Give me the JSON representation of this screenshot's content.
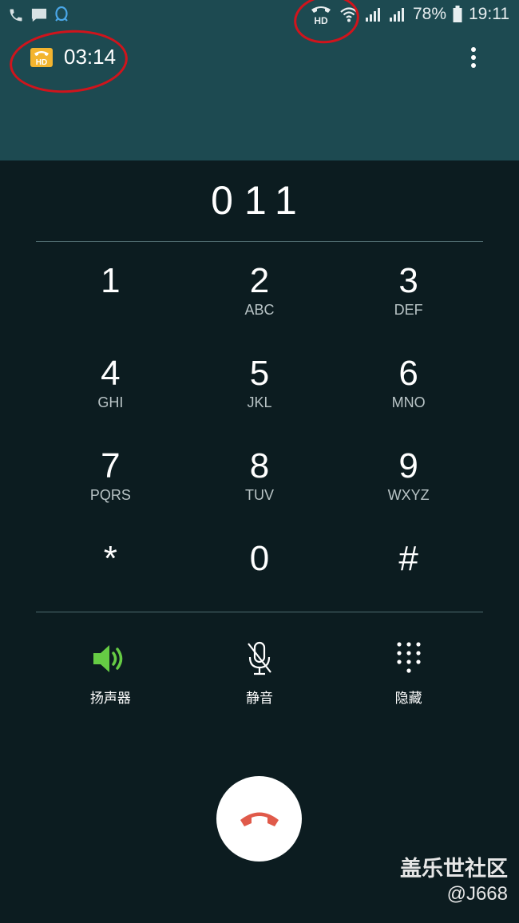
{
  "status_bar": {
    "battery": "78%",
    "time": "19:11",
    "icons_left": [
      "phone-icon",
      "message-icon",
      "qq-icon"
    ],
    "icons_right": [
      "hd-call-icon",
      "wifi-icon",
      "signal-icon",
      "signal-icon",
      "battery-icon"
    ]
  },
  "call": {
    "duration": "03:14",
    "hd_label": "HD"
  },
  "dialed_number": "011",
  "keypad": [
    {
      "digit": "1",
      "letters": ""
    },
    {
      "digit": "2",
      "letters": "ABC"
    },
    {
      "digit": "3",
      "letters": "DEF"
    },
    {
      "digit": "4",
      "letters": "GHI"
    },
    {
      "digit": "5",
      "letters": "JKL"
    },
    {
      "digit": "6",
      "letters": "MNO"
    },
    {
      "digit": "7",
      "letters": "PQRS"
    },
    {
      "digit": "8",
      "letters": "TUV"
    },
    {
      "digit": "9",
      "letters": "WXYZ"
    },
    {
      "digit": "*",
      "letters": ""
    },
    {
      "digit": "0",
      "letters": ""
    },
    {
      "digit": "#",
      "letters": ""
    }
  ],
  "controls": {
    "speaker": "扬声器",
    "mute": "静音",
    "hide": "隐藏"
  },
  "colors": {
    "header_bg": "#1d4a51",
    "body_bg": "#0c1c20",
    "speaker_green": "#66cc44",
    "end_call_red": "#e05a4a",
    "hd_badge": "#f3b52f",
    "annotation_red": "#d0141c"
  },
  "watermark": {
    "title": "盖乐世社区",
    "user": "@J668"
  }
}
